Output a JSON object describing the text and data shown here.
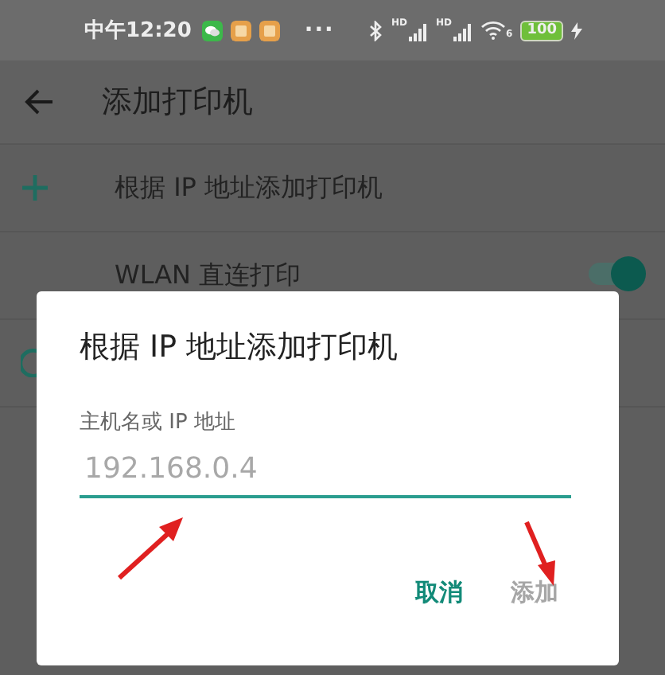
{
  "status_bar": {
    "time": "中午12:20",
    "more": "···",
    "signals": [
      {
        "label": "HD"
      },
      {
        "label": "HD"
      }
    ],
    "wifi_badge": "6",
    "battery": "100"
  },
  "app_bar": {
    "title": "添加打印机"
  },
  "list": [
    {
      "kind": "action",
      "label": "根据 IP 地址添加打印机"
    },
    {
      "kind": "toggle",
      "label": "WLAN 直连打印",
      "on": true
    },
    {
      "kind": "partial"
    }
  ],
  "dialog": {
    "title": "根据 IP 地址添加打印机",
    "field": {
      "label": "主机名或 IP 地址",
      "placeholder": "192.168.0.4",
      "focused": true
    },
    "buttons": [
      {
        "label": "取消",
        "disabled": false
      },
      {
        "label": "添加",
        "disabled": true
      }
    ]
  }
}
